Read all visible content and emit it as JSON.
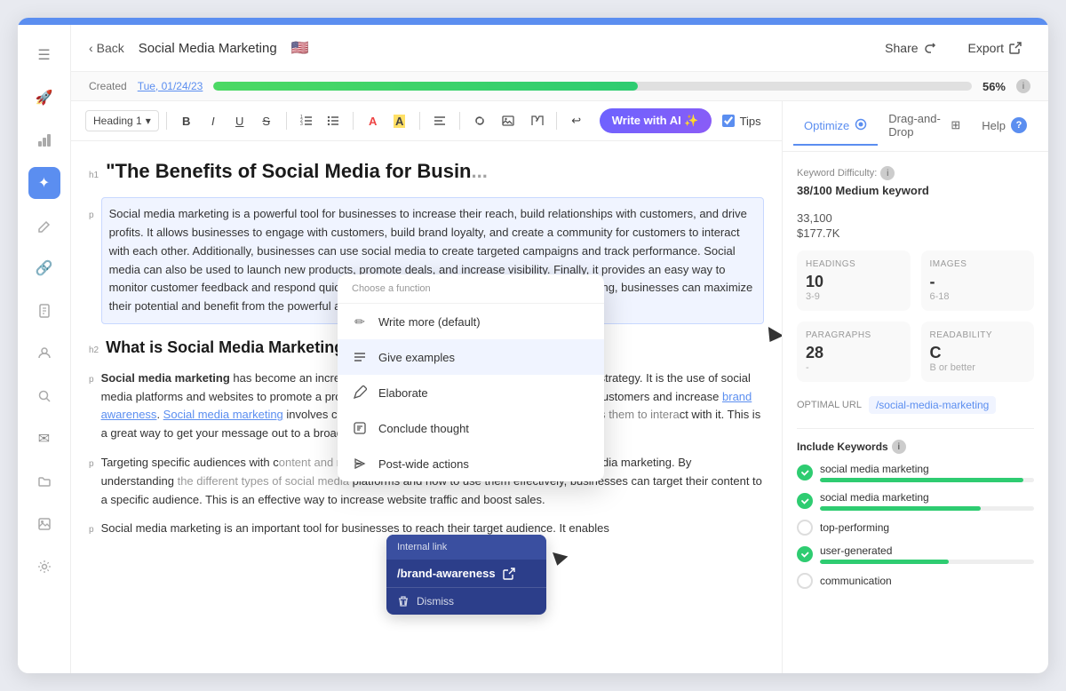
{
  "topbar": {
    "back_label": "Back",
    "page_title": "Social Media Marketing",
    "flag": "🇺🇸",
    "share_label": "Share",
    "export_label": "Export"
  },
  "progress": {
    "created_label": "Created",
    "created_date": "Tue, 01/24/23",
    "percent": 56,
    "percent_label": "56%",
    "bar_width": "56"
  },
  "toolbar": {
    "heading_label": "Heading 1",
    "write_ai_label": "Write with AI ✨",
    "tips_label": "Tips"
  },
  "right_panel": {
    "tab_optimize": "Optimize",
    "tab_drag_drop": "Drag-and-Drop",
    "tab_help": "Help",
    "keyword_difficulty_label": "Keyword Difficulty:",
    "keyword_difficulty_value": "38/100 Medium keyword",
    "volume_1": "33,100",
    "cpc_1": "$177.7K",
    "optimal_url_label": "OPTIMAL URL",
    "optimal_url_value": "/social-media-marketing",
    "include_keywords_label": "Include Keywords",
    "headings_label": "HEADINGS",
    "headings_value": "10",
    "headings_range": "3-9",
    "images_label": "IMAGES",
    "images_value": "-",
    "images_range": "6-18",
    "paragraphs_label": "PARAGRAPHS",
    "paragraphs_value": "28",
    "paragraphs_range": "-",
    "readability_label": "READABILITY",
    "readability_value": "C",
    "readability_range": "B or better",
    "keywords": [
      {
        "label": "social media marketing",
        "checked": true,
        "bar": 95
      },
      {
        "label": "social media marketing",
        "checked": true,
        "bar": 85
      },
      {
        "label": "top-performing",
        "checked": false,
        "bar": 0
      },
      {
        "label": "user-generated",
        "checked": true,
        "bar": 70
      },
      {
        "label": "communication",
        "checked": false,
        "bar": 0
      }
    ]
  },
  "editor": {
    "h1_marker": "h1",
    "h1_text": "\"The Benefits of Social Media for Busin",
    "p1_marker": "p",
    "p1_text": "Social media marketing is a powerful tool for businesses to increase their reach, build relationships with customers, and drive profits. It allows businesses to engage with customers, build brand loyalty, and create a community for customers to interact with each other. Additionally, businesses can use social media to create targeted campaigns and track performance. Social media can also be used to launch new products, promote deals, and increase visibility. Finally, it provides an easy way to monitor customer feedback and respond quickly to customer inquiries. With social media marketing, businesses can maximize their potential and benefit from the powerful advantages it offers.",
    "h2_marker": "h2",
    "h2_text": "What is Social Media Marketing?",
    "p2_marker": "p",
    "p2_part1": "Social media marketing",
    "p2_part2": " has become an increasingly important part of any business's marketing strategy. It is the use of social media platforms and websites to promote a product or service, as well as build relationships with customers and increase ",
    "p2_link": "brand awareness",
    "p2_part3": ". ",
    "p2_link2": "Social media marketing",
    "p2_part4": " involves creating content that engages with users, e",
    "p2_part5": "ct with it. This is a great way to get your message out to a broader",
    "p3_marker": "p",
    "p3_text": "Targeting specific audiences with c",
    "p3_text2": " other advantage of using social media marketing. By understanding",
    "p3_text3": " platforms and how to use them effectively, businesses can target their content to a specific audience. This is an effective way to increase website traffic and boost sales.",
    "p4_marker": "p",
    "p4_text": "Social media marketing is an important tool for businesses to reach their target audience. It enables"
  },
  "ai_dropdown": {
    "header": "Choose a function",
    "items": [
      {
        "icon": "✏️",
        "label": "Write more (default)"
      },
      {
        "icon": "≡",
        "label": "Give examples"
      },
      {
        "icon": "✏",
        "label": "Elaborate"
      },
      {
        "icon": "💡",
        "label": "Conclude thought"
      },
      {
        "icon": "↗",
        "label": "Post-wide actions"
      }
    ]
  },
  "internal_link": {
    "header": "Internal link",
    "link": "/brand-awareness",
    "dismiss": "Dismiss"
  },
  "sidebar": {
    "icons": [
      "☰",
      "🚀",
      "📊",
      "✨",
      "📝",
      "🔗",
      "📄",
      "👤",
      "🔍",
      "📧",
      "📁",
      "📊"
    ]
  }
}
